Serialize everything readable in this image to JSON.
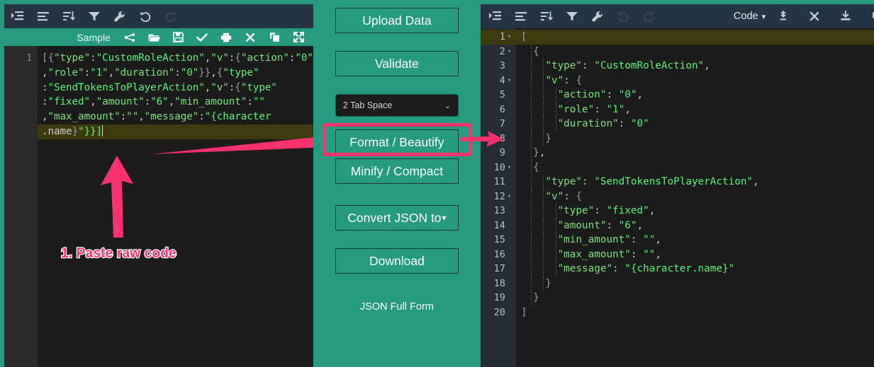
{
  "colors": {
    "teal": "#259a7e",
    "toolbar_navy": "#263544",
    "editor_bg": "#1b1b1b",
    "accent_pink": "#f9316f",
    "string_green": "#5ef07a",
    "active_line": "#3d3a10"
  },
  "left_panel": {
    "toolbar_icons": [
      {
        "name": "indent-icon",
        "glyph": "indent"
      },
      {
        "name": "align-left-icon",
        "glyph": "align"
      },
      {
        "name": "sort-icon",
        "glyph": "sort"
      },
      {
        "name": "filter-icon",
        "glyph": "filter"
      },
      {
        "name": "wrench-icon",
        "glyph": "wrench"
      },
      {
        "name": "undo-icon",
        "glyph": "undo"
      },
      {
        "name": "redo-icon",
        "glyph": "redo"
      }
    ],
    "subbar": {
      "sample_label": "Sample",
      "icons": [
        {
          "name": "share-icon"
        },
        {
          "name": "folder-open-icon"
        },
        {
          "name": "save-icon"
        },
        {
          "name": "check-icon"
        },
        {
          "name": "print-icon"
        },
        {
          "name": "close-icon"
        },
        {
          "name": "copy-icon"
        },
        {
          "name": "fullscreen-icon"
        }
      ]
    },
    "line_number": "1",
    "code_wrapped_lines": [
      "[{\"type\":\"CustomRoleAction\",\"v\":{\"action\":\"0\"",
      ",\"role\":\"1\",\"duration\":\"0\"}},{\"type\"",
      ":\"SendTokensToPlayerAction\",\"v\":{\"type\"",
      ":\"fixed\",\"amount\":\"6\",\"min_amount\":\"\"",
      ",\"max_amount\":\"\",\"message\":\"{character",
      ".name}\"}}]"
    ],
    "annotation": "1. Paste raw code"
  },
  "middle_panel": {
    "upload_label": "Upload Data",
    "validate_label": "Validate",
    "tab_space_value": "2 Tab Space",
    "format_label": "Format / Beautify",
    "minify_label": "Minify / Compact",
    "convert_label": "Convert JSON to",
    "convert_caret": "▾",
    "download_label": "Download",
    "full_form_label": "JSON Full Form"
  },
  "right_panel": {
    "toolbar_icons": [
      {
        "name": "indent-icon"
      },
      {
        "name": "align-left-icon"
      },
      {
        "name": "sort-icon"
      },
      {
        "name": "filter-icon"
      },
      {
        "name": "wrench-icon"
      },
      {
        "name": "undo-icon"
      },
      {
        "name": "redo-icon"
      }
    ],
    "view_mode_label": "Code",
    "view_mode_caret": "▾",
    "right_icons": [
      {
        "name": "collapse-all-icon"
      },
      {
        "name": "close-icon"
      },
      {
        "name": "download-icon"
      },
      {
        "name": "copy-icon"
      },
      {
        "name": "fullscreen-icon"
      }
    ],
    "lines": [
      {
        "n": "1",
        "fold": true,
        "indent": 0,
        "text": "["
      },
      {
        "n": "2",
        "fold": true,
        "indent": 1,
        "text": "  {"
      },
      {
        "n": "3",
        "fold": false,
        "indent": 2,
        "text": "    \"type\": \"CustomRoleAction\","
      },
      {
        "n": "4",
        "fold": true,
        "indent": 2,
        "text": "    \"v\": {"
      },
      {
        "n": "5",
        "fold": false,
        "indent": 3,
        "text": "      \"action\": \"0\","
      },
      {
        "n": "6",
        "fold": false,
        "indent": 3,
        "text": "      \"role\": \"1\","
      },
      {
        "n": "7",
        "fold": false,
        "indent": 3,
        "text": "      \"duration\": \"0\""
      },
      {
        "n": "8",
        "fold": false,
        "indent": 2,
        "text": "    }"
      },
      {
        "n": "9",
        "fold": false,
        "indent": 1,
        "text": "  },"
      },
      {
        "n": "10",
        "fold": true,
        "indent": 1,
        "text": "  {"
      },
      {
        "n": "11",
        "fold": false,
        "indent": 2,
        "text": "    \"type\": \"SendTokensToPlayerAction\","
      },
      {
        "n": "12",
        "fold": true,
        "indent": 2,
        "text": "    \"v\": {"
      },
      {
        "n": "13",
        "fold": false,
        "indent": 3,
        "text": "      \"type\": \"fixed\","
      },
      {
        "n": "14",
        "fold": false,
        "indent": 3,
        "text": "      \"amount\": \"6\","
      },
      {
        "n": "15",
        "fold": false,
        "indent": 3,
        "text": "      \"min_amount\": \"\","
      },
      {
        "n": "16",
        "fold": false,
        "indent": 3,
        "text": "      \"max_amount\": \"\","
      },
      {
        "n": "17",
        "fold": false,
        "indent": 3,
        "text": "      \"message\": \"{character.name}\""
      },
      {
        "n": "18",
        "fold": false,
        "indent": 2,
        "text": "    }"
      },
      {
        "n": "19",
        "fold": false,
        "indent": 1,
        "text": "  }"
      },
      {
        "n": "20",
        "fold": false,
        "indent": 0,
        "text": "]"
      }
    ]
  }
}
